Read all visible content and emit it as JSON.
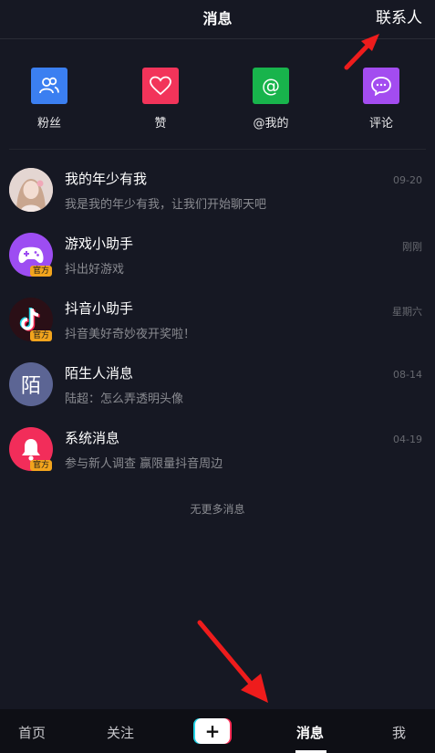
{
  "header": {
    "title": "消息",
    "contacts": "联系人"
  },
  "quick_actions": [
    {
      "label": "粉丝",
      "icon": "fans-icon",
      "color": "#3b7ff1"
    },
    {
      "label": "赞",
      "icon": "heart-icon",
      "color": "#f2345a"
    },
    {
      "label": "@我的",
      "icon": "at-icon",
      "color": "#18b44c"
    },
    {
      "label": "评论",
      "icon": "comment-icon",
      "color": "#a34cf0"
    }
  ],
  "conversations": [
    {
      "name": "我的年少有我",
      "preview": "我是我的年少有我，让我们开始聊天吧",
      "time": "09-20"
    },
    {
      "name": "游戏小助手",
      "preview": "抖出好游戏",
      "time": "刚刚",
      "badge": "官方"
    },
    {
      "name": "抖音小助手",
      "preview": "抖音美好奇妙夜开奖啦！",
      "time": "星期六",
      "badge": "官方"
    },
    {
      "name": "陌生人消息",
      "preview": "陆超：怎么弄透明头像",
      "time": "08-14",
      "avatar_text": "陌"
    },
    {
      "name": "系统消息",
      "preview": "参与新人调查 赢限量抖音周边",
      "time": "04-19",
      "badge": "官方"
    }
  ],
  "no_more": "无更多消息",
  "tabbar": {
    "home": "首页",
    "follow": "关注",
    "plus": "+",
    "messages": "消息",
    "me": "我"
  },
  "colors": {
    "background": "#161823",
    "tabbar": "#0e0f15",
    "arrow": "#ee1c1c",
    "badge": "#f2a41d"
  }
}
